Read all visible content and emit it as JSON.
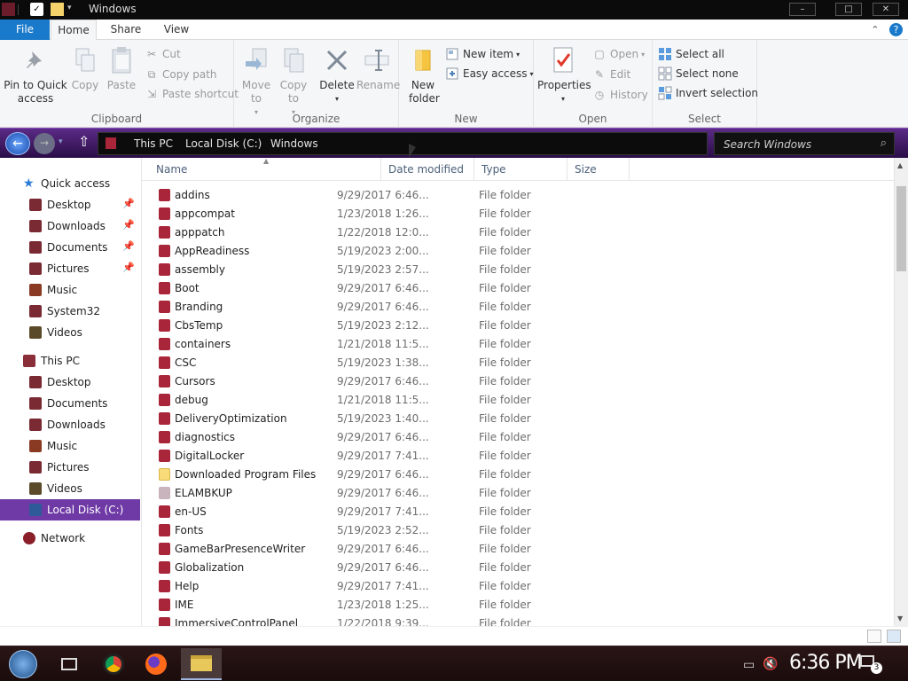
{
  "window": {
    "title": "Windows"
  },
  "ribbon_tabs": [
    "File",
    "Home",
    "Share",
    "View"
  ],
  "ribbon": {
    "clipboard": {
      "label": "Clipboard",
      "pin": "Pin to Quick access",
      "copy": "Copy",
      "paste": "Paste",
      "cut": "Cut",
      "copy_path": "Copy path",
      "paste_shortcut": "Paste shortcut"
    },
    "organize": {
      "label": "Organize",
      "move_to": "Move to",
      "copy_to": "Copy to",
      "delete": "Delete",
      "rename": "Rename"
    },
    "new": {
      "label": "New",
      "new_folder": "New folder",
      "new_item": "New item",
      "easy_access": "Easy access"
    },
    "open": {
      "label": "Open",
      "properties": "Properties",
      "open": "Open",
      "edit": "Edit",
      "history": "History"
    },
    "select": {
      "label": "Select",
      "select_all": "Select all",
      "select_none": "Select none",
      "invert": "Invert selection"
    }
  },
  "breadcrumb": [
    "This PC",
    "Local Disk (C:)",
    "Windows"
  ],
  "search": {
    "placeholder": "Search Windows"
  },
  "nav": {
    "quick_access": "Quick access",
    "quick_items": [
      "Desktop",
      "Downloads",
      "Documents",
      "Pictures",
      "Music",
      "System32",
      "Videos"
    ],
    "this_pc": "This PC",
    "pc_items": [
      "Desktop",
      "Documents",
      "Downloads",
      "Music",
      "Pictures",
      "Videos",
      "Local Disk (C:)"
    ],
    "network": "Network"
  },
  "columns": {
    "name": "Name",
    "date": "Date modified",
    "type": "Type",
    "size": "Size"
  },
  "files": [
    {
      "name": "addins",
      "date": "9/29/2017 6:46...",
      "type": "File folder"
    },
    {
      "name": "appcompat",
      "date": "1/23/2018 1:26...",
      "type": "File folder"
    },
    {
      "name": "apppatch",
      "date": "1/22/2018 12:0...",
      "type": "File folder"
    },
    {
      "name": "AppReadiness",
      "date": "5/19/2023 2:00...",
      "type": "File folder"
    },
    {
      "name": "assembly",
      "date": "5/19/2023 2:57...",
      "type": "File folder"
    },
    {
      "name": "Boot",
      "date": "9/29/2017 6:46...",
      "type": "File folder"
    },
    {
      "name": "Branding",
      "date": "9/29/2017 6:46...",
      "type": "File folder"
    },
    {
      "name": "CbsTemp",
      "date": "5/19/2023 2:12...",
      "type": "File folder"
    },
    {
      "name": "containers",
      "date": "1/21/2018 11:5...",
      "type": "File folder"
    },
    {
      "name": "CSC",
      "date": "5/19/2023 1:38...",
      "type": "File folder"
    },
    {
      "name": "Cursors",
      "date": "9/29/2017 6:46...",
      "type": "File folder"
    },
    {
      "name": "debug",
      "date": "1/21/2018 11:5...",
      "type": "File folder"
    },
    {
      "name": "DeliveryOptimization",
      "date": "5/19/2023 1:40...",
      "type": "File folder"
    },
    {
      "name": "diagnostics",
      "date": "9/29/2017 6:46...",
      "type": "File folder"
    },
    {
      "name": "DigitalLocker",
      "date": "9/29/2017 7:41...",
      "type": "File folder"
    },
    {
      "name": "Downloaded Program Files",
      "date": "9/29/2017 6:46...",
      "type": "File folder"
    },
    {
      "name": "ELAMBKUP",
      "date": "9/29/2017 6:46...",
      "type": "File folder"
    },
    {
      "name": "en-US",
      "date": "9/29/2017 7:41...",
      "type": "File folder"
    },
    {
      "name": "Fonts",
      "date": "5/19/2023 2:52...",
      "type": "File folder"
    },
    {
      "name": "GameBarPresenceWriter",
      "date": "9/29/2017 6:46...",
      "type": "File folder"
    },
    {
      "name": "Globalization",
      "date": "9/29/2017 6:46...",
      "type": "File folder"
    },
    {
      "name": "Help",
      "date": "9/29/2017 7:41...",
      "type": "File folder"
    },
    {
      "name": "IME",
      "date": "1/23/2018 1:25...",
      "type": "File folder"
    },
    {
      "name": "ImmersiveControlPanel",
      "date": "1/22/2018 9:39...",
      "type": "File folder"
    }
  ],
  "taskbar": {
    "time": "6:36 PM",
    "notifications": "3"
  },
  "colors": {
    "accent": "#1979ca",
    "nav_selected": "#6f3aa6",
    "address_bar": "#3d1763",
    "folder_icon": "#a8253a"
  }
}
